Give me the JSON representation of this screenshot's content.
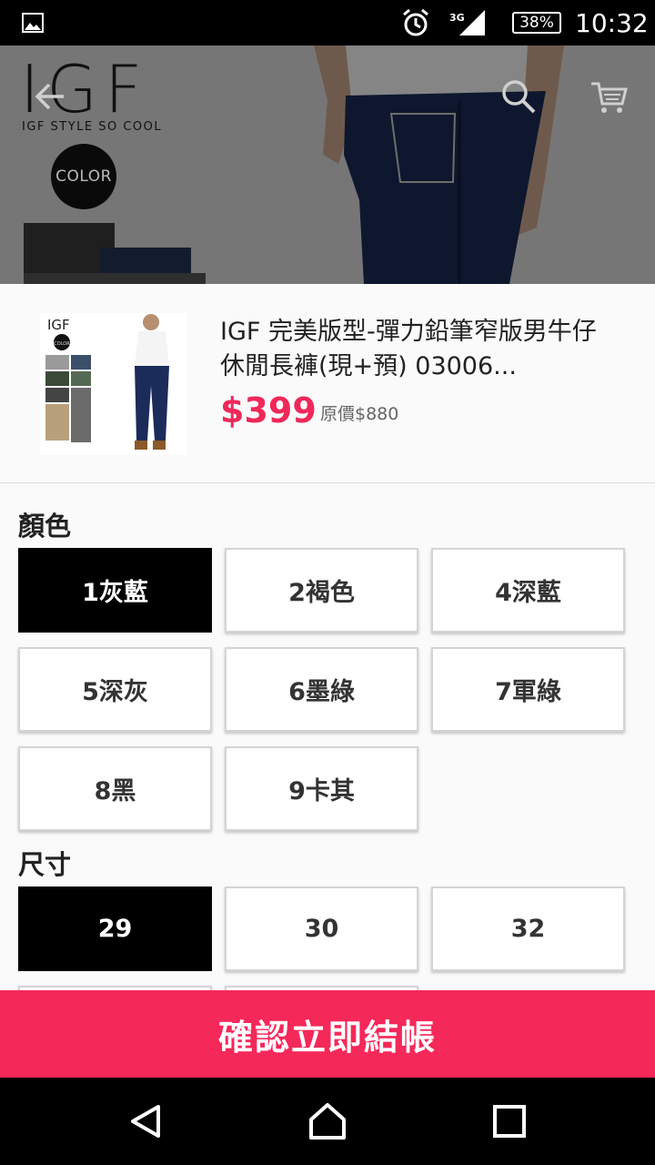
{
  "status_bar": {
    "network": "3G",
    "battery": "38%",
    "time": "10:32",
    "icons": [
      "image-notification-icon",
      "alarm-icon",
      "signal-icon",
      "battery-icon"
    ]
  },
  "hero": {
    "brand": "IGF",
    "tagline": "IGF STYLE SO COOL",
    "badge": "COLOR",
    "icons": [
      "back-arrow-icon",
      "search-icon",
      "cart-icon"
    ]
  },
  "product": {
    "title": "IGF 完美版型-彈力鉛筆窄版男牛仔休閒長褲(現+預) 03006...",
    "price": "$399",
    "original_price": "原價$880",
    "thumb_brand": "IGF",
    "thumb_badge": "COLOR"
  },
  "color_section": {
    "label": "顏色",
    "options": [
      "1灰藍",
      "2褐色",
      "4深藍",
      "5深灰",
      "6墨綠",
      "7軍綠",
      "8黑",
      "9卡其"
    ],
    "selected": "1灰藍"
  },
  "size_section": {
    "label": "尺寸",
    "options": [
      "29",
      "30",
      "32"
    ],
    "selected": "29"
  },
  "checkout": {
    "label": "確認立即結帳"
  },
  "colors": {
    "accent": "#f5285a",
    "price": "#f0285a",
    "selected_bg": "#000000"
  },
  "nav_bar": {
    "icons": [
      "back-nav-icon",
      "home-nav-icon",
      "recents-nav-icon"
    ]
  }
}
